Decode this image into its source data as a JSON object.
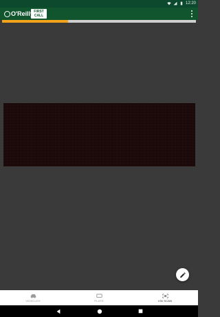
{
  "status_bar": {
    "time": "12:20",
    "icons": [
      "wifi-icon",
      "signal-icon",
      "battery-icon"
    ]
  },
  "app_bar": {
    "brand_logo_text": "O'Reilly",
    "secondary_logo_text_line1": "FIRST",
    "secondary_logo_text_line2": "CALL",
    "menu_icon": "overflow-menu-icon"
  },
  "progress": {
    "value_fraction": 0.34,
    "fill_color": "#f3a21b",
    "track_color": "#cfcfcf"
  },
  "camera": {
    "fab_icon": "pencil-icon"
  },
  "bottom_nav": {
    "items": [
      {
        "label": "VEHICLES",
        "icon": "car-icon",
        "active": false
      },
      {
        "label": "PLATE",
        "icon": "plate-icon",
        "active": false
      },
      {
        "label": "VIN SCAN",
        "icon": "barcode-scan-icon",
        "active": true
      }
    ]
  },
  "system_nav": {
    "buttons": [
      "back-icon",
      "home-icon",
      "recents-icon"
    ]
  },
  "colors": {
    "brand_green": "#11552f",
    "accent_orange": "#f3a21b"
  }
}
